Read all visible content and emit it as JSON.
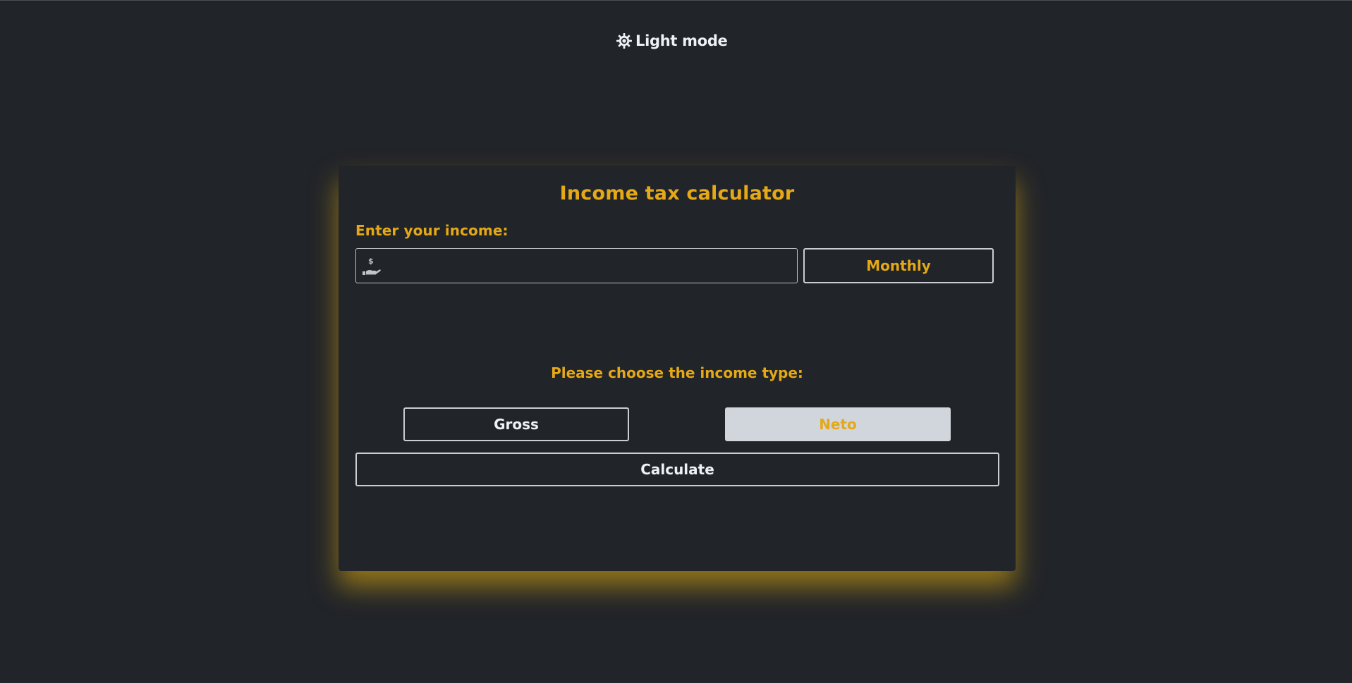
{
  "theme_toggle": {
    "label": "Light mode",
    "icon": "sun-gear-icon"
  },
  "calculator": {
    "title": "Income tax calculator",
    "income_label": "Enter your income:",
    "income_input": {
      "value": "",
      "placeholder": "",
      "icon": "hand-dollar-icon"
    },
    "period_selected": "Monthly",
    "income_type_label": "Please choose the income type:",
    "income_types": {
      "gross": "Gross",
      "neto": "Neto"
    },
    "selected_income_type": "Neto",
    "calculate_label": "Calculate"
  },
  "colors": {
    "background": "#212429",
    "accent": "#e5a816",
    "text_light": "#eef1f6",
    "border": "#c9ced5",
    "selected_fill": "#d1d5dc",
    "glow": "#eeb60d"
  }
}
